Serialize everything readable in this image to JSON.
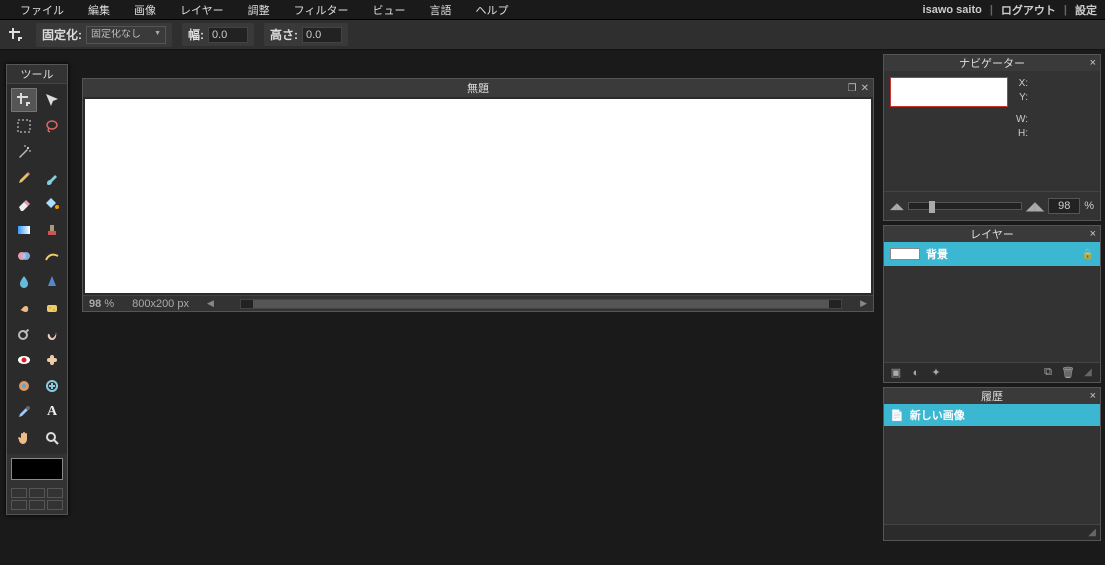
{
  "menu": {
    "items": [
      "ファイル",
      "編集",
      "画像",
      "レイヤー",
      "調整",
      "フィルター",
      "ビュー",
      "言語",
      "ヘルプ"
    ],
    "user": "isawo saito",
    "logout": "ログアウト",
    "settings": "設定"
  },
  "options": {
    "fixation_label": "固定化:",
    "fixation_value": "固定化なし",
    "width_label": "幅:",
    "width_value": "0.0",
    "height_label": "高さ:",
    "height_value": "0.0"
  },
  "tools": {
    "title": "ツール",
    "items": [
      "crop",
      "move",
      "marquee",
      "lasso",
      "wand",
      "",
      "pencil",
      "brush",
      "eraser",
      "paint-bucket",
      "gradient",
      "clone-stamp",
      "color-replace",
      "drawing",
      "blur",
      "sharpen",
      "smudge",
      "sponge",
      "dodge",
      "burn",
      "red-eye",
      "spot-heal",
      "bloat",
      "pinch",
      "color-picker",
      "type",
      "hand",
      "zoom"
    ],
    "selected_index": 0,
    "foreground_color": "#000000"
  },
  "canvas": {
    "title": "無題",
    "zoom_display": "98",
    "zoom_unit": "%",
    "dimensions": "800x200 px"
  },
  "navigator": {
    "title": "ナビゲーター",
    "labels": {
      "x": "X:",
      "y": "Y:",
      "w": "W:",
      "h": "H:"
    },
    "zoom_value": "98",
    "zoom_unit": "%"
  },
  "layers": {
    "title": "レイヤー",
    "items": [
      {
        "name": "背景",
        "locked": true
      }
    ]
  },
  "history": {
    "title": "履歴",
    "items": [
      {
        "label": "新しい画像"
      }
    ]
  }
}
